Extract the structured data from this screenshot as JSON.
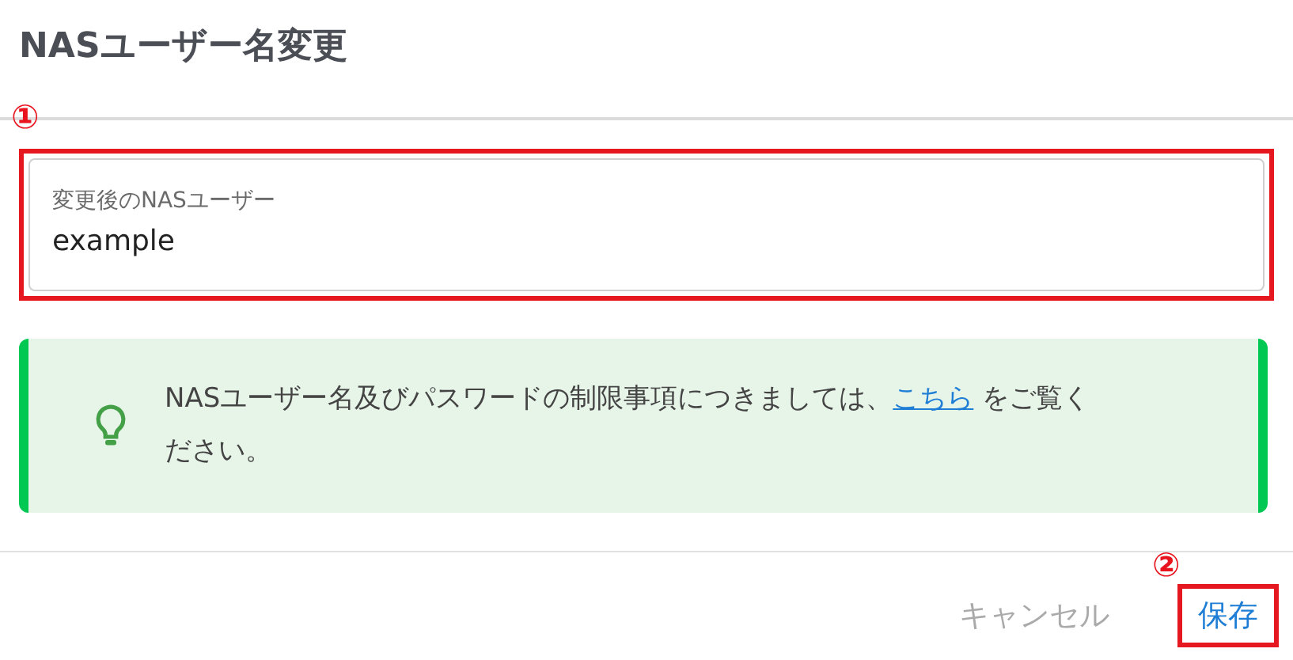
{
  "dialog": {
    "title": "NASユーザー名変更"
  },
  "field": {
    "label": "変更後のNASユーザー",
    "value": "example",
    "callout": "①",
    "highlighted": true
  },
  "notice": {
    "text_before": "NASユーザー名及びパスワードの制限事項につきましては、",
    "link": "こちら",
    "text_after": " をご覧ください。"
  },
  "buttons": [
    {
      "label": "キャンセル",
      "kind": "cancel",
      "disabled": true,
      "highlighted": false
    },
    {
      "label": "保存",
      "kind": "save",
      "disabled": false,
      "highlighted": true,
      "callout": "②"
    }
  ]
}
